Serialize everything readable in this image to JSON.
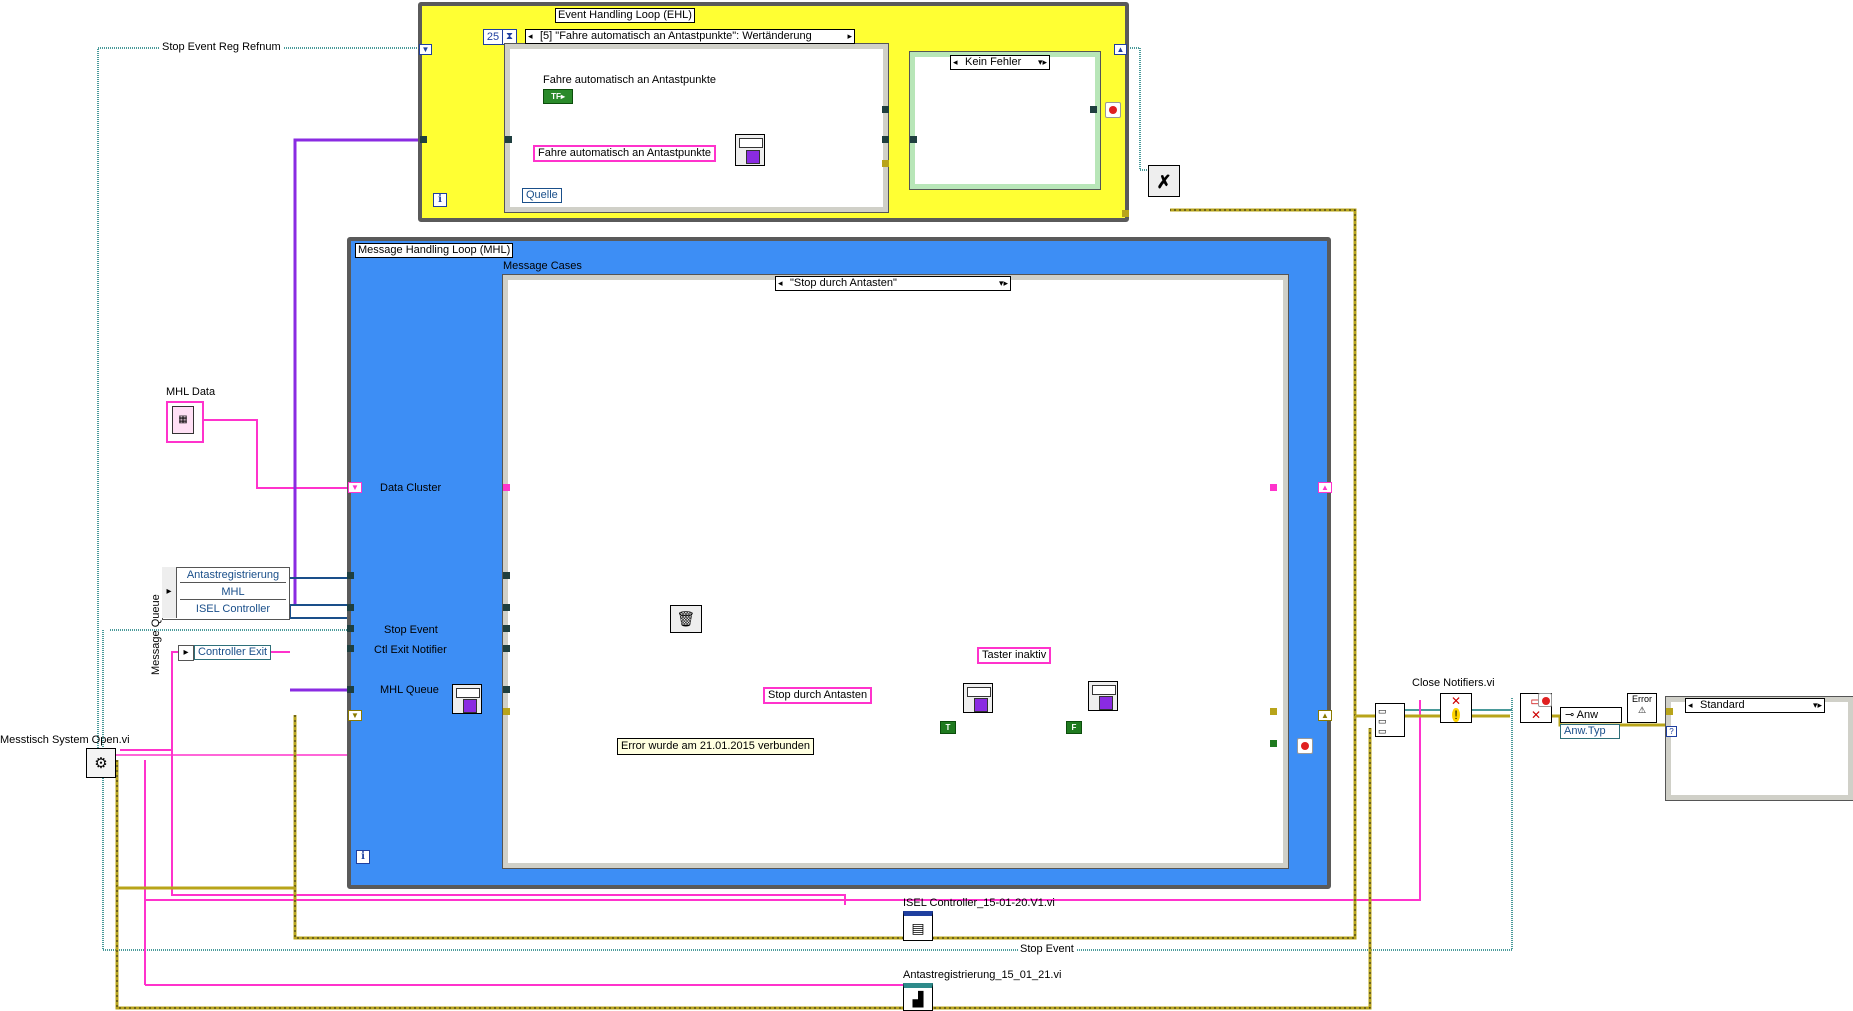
{
  "ehl": {
    "title": "Event Handling Loop (EHL)",
    "timeout": "25",
    "event_case": "[5] \"Fahre automatisch an Antastpunkte\": Wertänderung",
    "control_label": "Fahre automatisch an Antastpunkte",
    "string_const": "Fahre automatisch an Antastpunkte",
    "source_label": "Quelle",
    "error_case": "Kein Fehler"
  },
  "mhl": {
    "title": "Message Handling Loop (MHL)",
    "cases_label": "Message Cases",
    "case_selector": "\"Stop durch Antasten\"",
    "data_cluster": "Data Cluster",
    "stop_event": "Stop Event",
    "ctl_exit_notifier": "Ctl Exit Notifier",
    "mhl_queue": "MHL Queue",
    "msg_stop": "Stop durch Antasten",
    "msg_taster": "Taster inaktiv",
    "bool_true": "T",
    "bool_false": "F",
    "comment": "Error wurde am 21.01.2015 verbunden"
  },
  "left": {
    "stop_event_refnum": "Stop Event Reg Refnum",
    "mhl_data": "MHL Data",
    "message_queue_label": "Message Queue",
    "queue_items": [
      "Antastregistrierung",
      "MHL",
      "ISEL Controller"
    ],
    "controller_exit": "Controller Exit",
    "open_vi": "Messtisch System Open.vi"
  },
  "bottom": {
    "isel_vi": "ISEL Controller_15-01-20.V1.vi",
    "stop_event": "Stop Event",
    "antast_vi": "Antastregistrierung_15_01_21.vi"
  },
  "right": {
    "close_notifiers": "Close Notifiers.vi",
    "anw": "Anw",
    "anw_typ": "Anw.Typ",
    "standard_case": "Standard"
  },
  "colors": {
    "ehl_fill": "#ffff33",
    "mhl_fill": "#3d8ef5",
    "pink_wire": "#ff33cc",
    "purple_wire": "#8a2be2",
    "teal_wire": "#4a9a9a",
    "error_wire": "#b8a41a"
  }
}
